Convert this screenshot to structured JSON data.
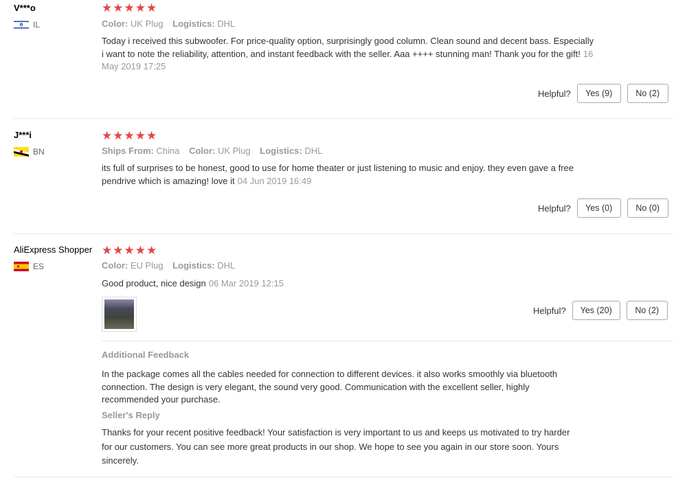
{
  "labels": {
    "helpful": "Helpful?",
    "color": "Color:",
    "logistics": "Logistics:",
    "ships_from": "Ships From:",
    "additional_feedback": "Additional Feedback",
    "sellers_reply": "Seller's Reply"
  },
  "stars_glyph": "★★★★★",
  "reviews": [
    {
      "user": "V***o",
      "country": "IL",
      "rating": 5,
      "color": "UK Plug",
      "logistics": "DHL",
      "text": "Today i received this subwoofer. For price-quality option, surprisingly good column. Clean sound and decent bass. Especially i want to note the reliability, attention, and instant feedback with the seller. Aaa ++++ stunning man! Thank you for the gift!",
      "date": "16 May 2019 17:25",
      "yes": "Yes (9)",
      "no": "No (2)"
    },
    {
      "user": "J***i",
      "country": "BN",
      "rating": 5,
      "ships_from": "China",
      "color": "UK Plug",
      "logistics": "DHL",
      "text": "its full of surprises to be honest, good to use for home theater or just listening to music and enjoy. they even gave a free pendrive which is amazing! love it",
      "date": "04 Jun 2019 16:49",
      "yes": "Yes (0)",
      "no": "No (0)"
    },
    {
      "user": "AliExpress Shopper",
      "country": "ES",
      "rating": 5,
      "color": "EU Plug",
      "logistics": "DHL",
      "text": "Good product, nice design",
      "date": "06 Mar 2019 12:15",
      "yes": "Yes (20)",
      "no": "No (2)",
      "additional_feedback": "In the package comes all the cables needed for connection to different devices. it also works smoothly via bluetooth connection. The design is very elegant, the sound very good. Communication with the excellent seller, highly recommended your purchase.",
      "sellers_reply": "Thanks for your recent positive feedback! Your satisfaction is very important to us and keeps us motivated to try harder for our customers. You can see more great products in our shop. We hope to see you again in our store soon. Yours sincerely."
    }
  ],
  "colors": {
    "star": "#e64545",
    "muted": "#999999",
    "border": "#e8e8e8"
  }
}
